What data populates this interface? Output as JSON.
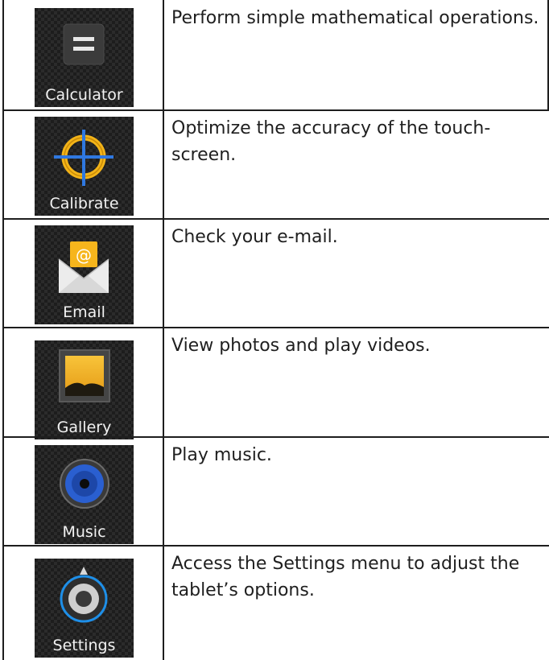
{
  "apps": [
    {
      "label": "Calculator",
      "icon": "calculator-icon",
      "description": "Perform simple mathematical operations."
    },
    {
      "label": "Calibrate",
      "icon": "calibrate-crosshair-icon",
      "description": "Optimize the accuracy of the touch-screen."
    },
    {
      "label": "Email",
      "icon": "email-envelope-icon",
      "description": "Check your e-mail."
    },
    {
      "label": "Gallery",
      "icon": "gallery-photo-icon",
      "description": "View photos and play videos."
    },
    {
      "label": "Music",
      "icon": "music-speaker-icon",
      "description": "Play music."
    },
    {
      "label": "Settings",
      "icon": "settings-knob-icon",
      "description": "Access the Settings menu to adjust the tablet’s options."
    }
  ],
  "colors": {
    "border": "#1e1e1e",
    "tile_background": "#1d1d1d",
    "label_text": "#f2f2f2",
    "calibrate_accent": "#f3b418",
    "calibrate_cross": "#2f78e0",
    "email_accent": "#f6b51c",
    "music_accent": "#2a5fd0"
  }
}
